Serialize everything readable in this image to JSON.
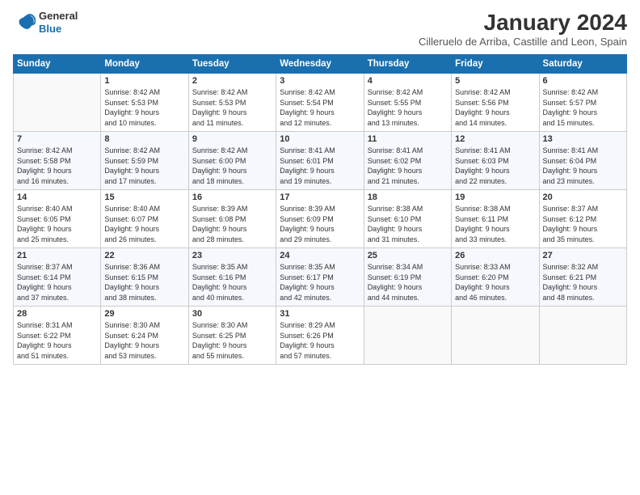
{
  "logo": {
    "line1": "General",
    "line2": "Blue"
  },
  "title": "January 2024",
  "location": "Cilleruelo de Arriba, Castille and Leon, Spain",
  "days_of_week": [
    "Sunday",
    "Monday",
    "Tuesday",
    "Wednesday",
    "Thursday",
    "Friday",
    "Saturday"
  ],
  "weeks": [
    [
      {
        "day": "",
        "info": ""
      },
      {
        "day": "1",
        "info": "Sunrise: 8:42 AM\nSunset: 5:53 PM\nDaylight: 9 hours\nand 10 minutes."
      },
      {
        "day": "2",
        "info": "Sunrise: 8:42 AM\nSunset: 5:53 PM\nDaylight: 9 hours\nand 11 minutes."
      },
      {
        "day": "3",
        "info": "Sunrise: 8:42 AM\nSunset: 5:54 PM\nDaylight: 9 hours\nand 12 minutes."
      },
      {
        "day": "4",
        "info": "Sunrise: 8:42 AM\nSunset: 5:55 PM\nDaylight: 9 hours\nand 13 minutes."
      },
      {
        "day": "5",
        "info": "Sunrise: 8:42 AM\nSunset: 5:56 PM\nDaylight: 9 hours\nand 14 minutes."
      },
      {
        "day": "6",
        "info": "Sunrise: 8:42 AM\nSunset: 5:57 PM\nDaylight: 9 hours\nand 15 minutes."
      }
    ],
    [
      {
        "day": "7",
        "info": "Sunrise: 8:42 AM\nSunset: 5:58 PM\nDaylight: 9 hours\nand 16 minutes."
      },
      {
        "day": "8",
        "info": "Sunrise: 8:42 AM\nSunset: 5:59 PM\nDaylight: 9 hours\nand 17 minutes."
      },
      {
        "day": "9",
        "info": "Sunrise: 8:42 AM\nSunset: 6:00 PM\nDaylight: 9 hours\nand 18 minutes."
      },
      {
        "day": "10",
        "info": "Sunrise: 8:41 AM\nSunset: 6:01 PM\nDaylight: 9 hours\nand 19 minutes."
      },
      {
        "day": "11",
        "info": "Sunrise: 8:41 AM\nSunset: 6:02 PM\nDaylight: 9 hours\nand 21 minutes."
      },
      {
        "day": "12",
        "info": "Sunrise: 8:41 AM\nSunset: 6:03 PM\nDaylight: 9 hours\nand 22 minutes."
      },
      {
        "day": "13",
        "info": "Sunrise: 8:41 AM\nSunset: 6:04 PM\nDaylight: 9 hours\nand 23 minutes."
      }
    ],
    [
      {
        "day": "14",
        "info": "Sunrise: 8:40 AM\nSunset: 6:05 PM\nDaylight: 9 hours\nand 25 minutes."
      },
      {
        "day": "15",
        "info": "Sunrise: 8:40 AM\nSunset: 6:07 PM\nDaylight: 9 hours\nand 26 minutes."
      },
      {
        "day": "16",
        "info": "Sunrise: 8:39 AM\nSunset: 6:08 PM\nDaylight: 9 hours\nand 28 minutes."
      },
      {
        "day": "17",
        "info": "Sunrise: 8:39 AM\nSunset: 6:09 PM\nDaylight: 9 hours\nand 29 minutes."
      },
      {
        "day": "18",
        "info": "Sunrise: 8:38 AM\nSunset: 6:10 PM\nDaylight: 9 hours\nand 31 minutes."
      },
      {
        "day": "19",
        "info": "Sunrise: 8:38 AM\nSunset: 6:11 PM\nDaylight: 9 hours\nand 33 minutes."
      },
      {
        "day": "20",
        "info": "Sunrise: 8:37 AM\nSunset: 6:12 PM\nDaylight: 9 hours\nand 35 minutes."
      }
    ],
    [
      {
        "day": "21",
        "info": "Sunrise: 8:37 AM\nSunset: 6:14 PM\nDaylight: 9 hours\nand 37 minutes."
      },
      {
        "day": "22",
        "info": "Sunrise: 8:36 AM\nSunset: 6:15 PM\nDaylight: 9 hours\nand 38 minutes."
      },
      {
        "day": "23",
        "info": "Sunrise: 8:35 AM\nSunset: 6:16 PM\nDaylight: 9 hours\nand 40 minutes."
      },
      {
        "day": "24",
        "info": "Sunrise: 8:35 AM\nSunset: 6:17 PM\nDaylight: 9 hours\nand 42 minutes."
      },
      {
        "day": "25",
        "info": "Sunrise: 8:34 AM\nSunset: 6:19 PM\nDaylight: 9 hours\nand 44 minutes."
      },
      {
        "day": "26",
        "info": "Sunrise: 8:33 AM\nSunset: 6:20 PM\nDaylight: 9 hours\nand 46 minutes."
      },
      {
        "day": "27",
        "info": "Sunrise: 8:32 AM\nSunset: 6:21 PM\nDaylight: 9 hours\nand 48 minutes."
      }
    ],
    [
      {
        "day": "28",
        "info": "Sunrise: 8:31 AM\nSunset: 6:22 PM\nDaylight: 9 hours\nand 51 minutes."
      },
      {
        "day": "29",
        "info": "Sunrise: 8:30 AM\nSunset: 6:24 PM\nDaylight: 9 hours\nand 53 minutes."
      },
      {
        "day": "30",
        "info": "Sunrise: 8:30 AM\nSunset: 6:25 PM\nDaylight: 9 hours\nand 55 minutes."
      },
      {
        "day": "31",
        "info": "Sunrise: 8:29 AM\nSunset: 6:26 PM\nDaylight: 9 hours\nand 57 minutes."
      },
      {
        "day": "",
        "info": ""
      },
      {
        "day": "",
        "info": ""
      },
      {
        "day": "",
        "info": ""
      }
    ]
  ]
}
